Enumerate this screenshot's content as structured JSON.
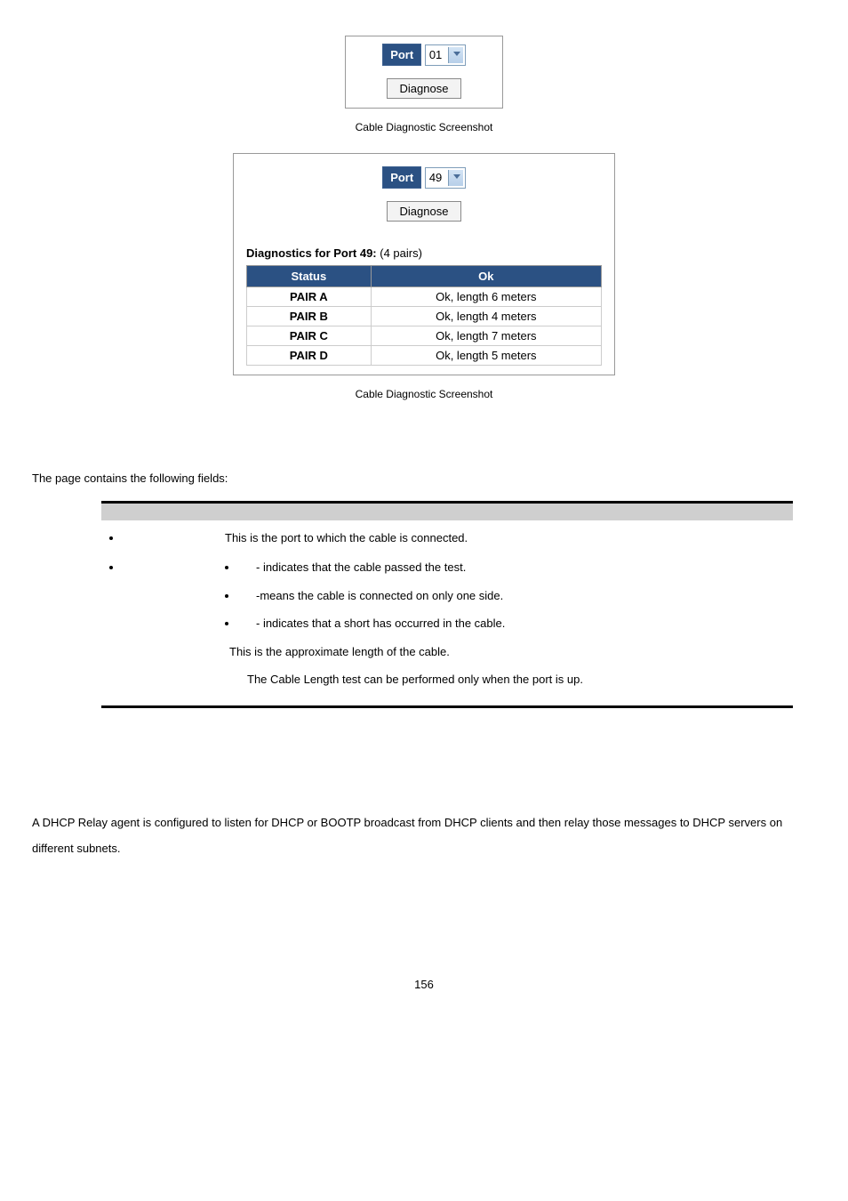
{
  "fig1": {
    "port_label": "Port",
    "port_value": "01",
    "diagnose": "Diagnose",
    "caption": "Cable Diagnostic Screenshot"
  },
  "fig2": {
    "port_label": "Port",
    "port_value": "49",
    "diagnose": "Diagnose",
    "header_label": "Diagnostics for Port 49:",
    "header_count": "(4 pairs)",
    "table": {
      "h1": "Status",
      "h2": "Ok",
      "rows": [
        {
          "pair": "PAIR A",
          "status": "Ok, length 6 meters"
        },
        {
          "pair": "PAIR B",
          "status": "Ok, length 4 meters"
        },
        {
          "pair": "PAIR C",
          "status": "Ok, length 7 meters"
        },
        {
          "pair": "PAIR D",
          "status": "Ok, length 5 meters"
        }
      ]
    },
    "caption": "Cable Diagnostic Screenshot"
  },
  "fields": {
    "intro": "The page contains the following fields:",
    "port_desc": "This is the port to which the cable is connected.",
    "ok": "- indicates that the cable passed the test.",
    "open": "-means the cable is connected on only one side.",
    "short": "- indicates that a short has occurred in the cable.",
    "length": "This is the approximate length of the cable.",
    "note": "The Cable Length test can be performed only when the port is up."
  },
  "dhcp": "A DHCP Relay agent is configured to listen for DHCP or BOOTP broadcast from DHCP clients and then relay those messages to DHCP servers on different subnets.",
  "page_number": "156"
}
